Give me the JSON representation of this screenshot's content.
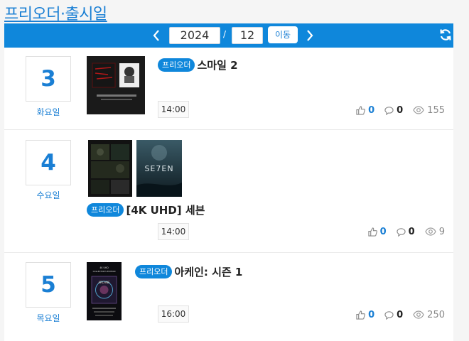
{
  "page": {
    "title": "프리오더·출시일"
  },
  "nav": {
    "year": "2024",
    "separator": "/",
    "month": "12",
    "go_label": "이동"
  },
  "entries": [
    {
      "day": "3",
      "weekday": "화요일",
      "badge": "프리오더",
      "title": "스마일 2",
      "time": "14:00",
      "likes": "0",
      "comments": "0",
      "views": "155"
    },
    {
      "day": "4",
      "weekday": "수요일",
      "badge": "프리오더",
      "title": "[4K UHD] 세븐",
      "cover_text": "SE7EN",
      "time": "14:00",
      "likes": "0",
      "comments": "0",
      "views": "9"
    },
    {
      "day": "5",
      "weekday": "목요일",
      "badge": "프리오더",
      "title": "아케인: 시즌 1",
      "cover_text_top": "4K UHD\nCOLLECTOR'S EDITION",
      "cover_text_logo": "ARCANE",
      "time": "16:00",
      "likes": "0",
      "comments": "0",
      "views": "250"
    }
  ],
  "colors": {
    "accent": "#0f87db",
    "link": "#1a7fd4"
  }
}
